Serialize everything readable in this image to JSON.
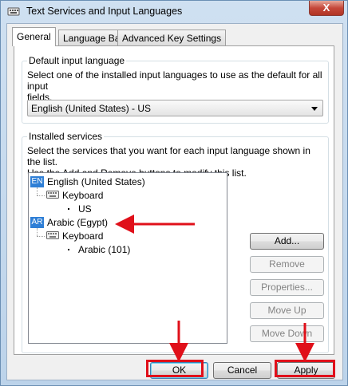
{
  "window": {
    "title": "Text Services and Input Languages",
    "close_label": "X"
  },
  "tabs": [
    {
      "label": "General",
      "active": true
    },
    {
      "label": "Language Bar",
      "active": false
    },
    {
      "label": "Advanced Key Settings",
      "active": false
    }
  ],
  "default_group": {
    "legend": "Default input language",
    "description_line1": "Select one of the installed input languages to use as the default for all input",
    "description_line2": "fields.",
    "selected_value": "English (United States) - US"
  },
  "services_group": {
    "legend": "Installed services",
    "description_line1": "Select the services that you want for each input language shown in the list.",
    "description_line2": "Use the Add and Remove buttons to modify this list.",
    "tree": [
      {
        "badge": "EN",
        "language": "English (United States)",
        "keyboard_label": "Keyboard",
        "layout": "US"
      },
      {
        "badge": "AR",
        "language": "Arabic (Egypt)",
        "keyboard_label": "Keyboard",
        "layout": "Arabic (101)"
      }
    ]
  },
  "buttons": {
    "add": "Add...",
    "remove": "Remove",
    "properties": "Properties...",
    "move_up": "Move Up",
    "move_down": "Move Down",
    "ok": "OK",
    "cancel": "Cancel",
    "apply": "Apply"
  },
  "annotation_color": "#e0101a"
}
